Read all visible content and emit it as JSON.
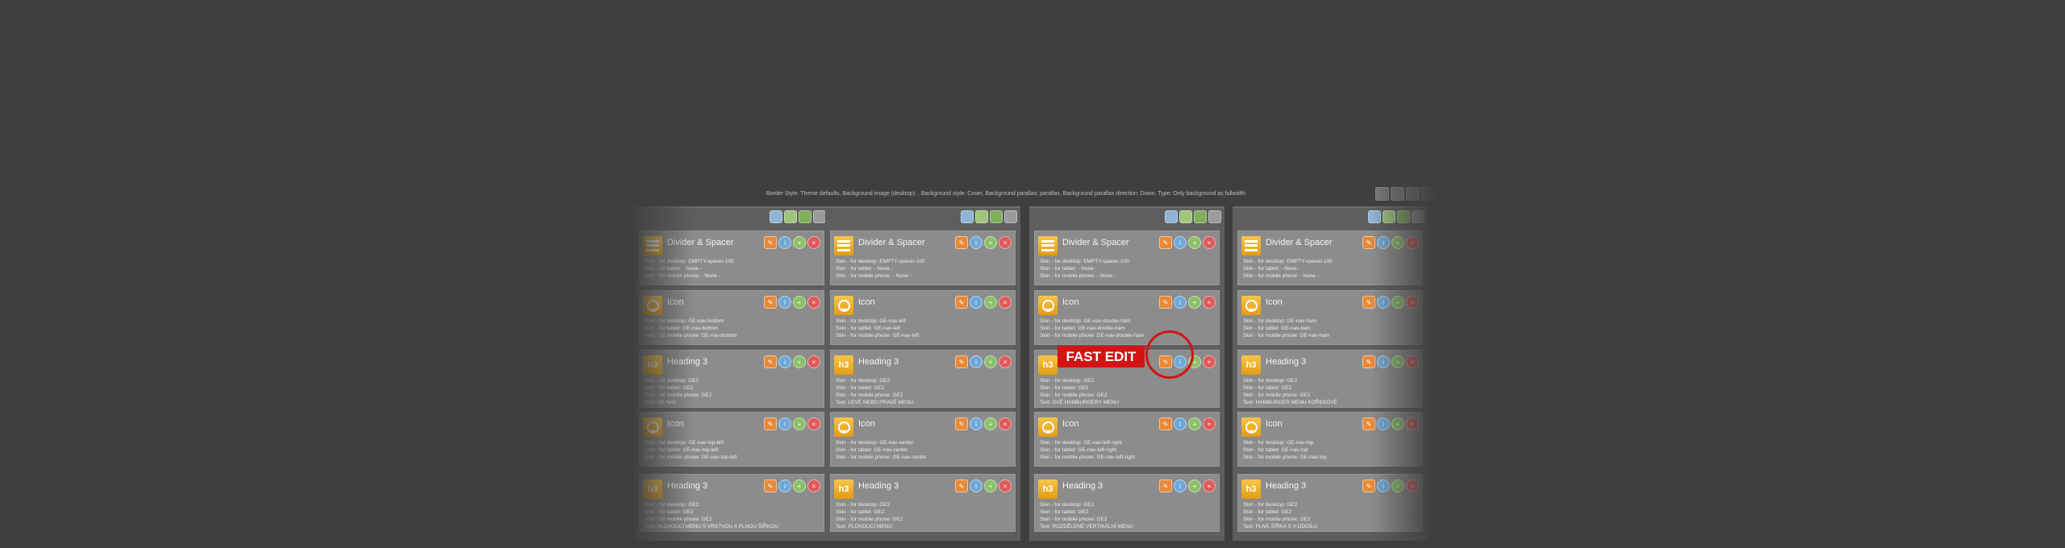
{
  "row_settings": {
    "text": "Border Style: Theme defaults, Background image (desktop):  , Background style: Cover, Background parallax: parallax, Background parallax direction: Down, Type: Only background as fullwidth"
  },
  "fast_edit": {
    "label": "FAST EDIT"
  },
  "columns": [
    {
      "modules": [
        {
          "icon": "divider-icon",
          "title": "Divider & Spacer",
          "lines": [
            "Skin - for desktop: EMPTY-spacer-100",
            "Skin - for tablet: - None -",
            "Skin - for mobile phone: - None -"
          ]
        },
        {
          "icon": "smiley-icon",
          "title": "Icon",
          "lines": [
            "Skin - for desktop: GE-nav-bottom",
            "Skin - for tablet: GE-nav-bottom",
            "Skin - for mobile phone: GE-nav-bottom"
          ]
        },
        {
          "icon": "h3-icon",
          "title": "Heading 3",
          "lines": [
            "Skin - for desktop: GE2",
            "Skin - for tablet: GE2",
            "Skin - for mobile phone: GE2",
            "Text: GE NAV"
          ]
        },
        {
          "icon": "smiley-icon",
          "title": "Icon",
          "lines": [
            "Skin - for desktop: GE-nav-top-left",
            "Skin - for tablet: GE-nav-top-left",
            "Skin - for mobile phone: GE-nav-top-left"
          ]
        },
        {
          "icon": "h3-icon",
          "title": "Heading 3",
          "lines": [
            "Skin - for desktop: GE2",
            "Skin - for tablet: GE2",
            "Skin - for mobile phone: GE2",
            "Text: PLOVOUCÍ MENU S VRSTVOU A PLNOU ŠÍŘKOU"
          ]
        }
      ]
    },
    {
      "modules": [
        {
          "icon": "divider-icon",
          "title": "Divider & Spacer",
          "lines": [
            "Skin - for desktop: EMPTY-spacer-100",
            "Skin - for tablet: - None -",
            "Skin - for mobile phone: - None -"
          ]
        },
        {
          "icon": "smiley-icon",
          "title": "Icon",
          "lines": [
            "Skin - for desktop: GE-nav-left",
            "Skin - for tablet: GE-nav-left",
            "Skin - for mobile phone: GE-nav-left"
          ]
        },
        {
          "icon": "h3-icon",
          "title": "Heading 3",
          "lines": [
            "Skin - for desktop: GE2",
            "Skin - for tablet: GE2",
            "Skin - for mobile phone: GE2",
            "Text: LEVÉ NEBO PRAVÉ MENU"
          ]
        },
        {
          "icon": "smiley-icon",
          "title": "Icon",
          "lines": [
            "Skin - for desktop: GE-nav-center",
            "Skin - for tablet: GE-nav-center",
            "Skin - for mobile phone: GE-nav-center"
          ]
        },
        {
          "icon": "h3-icon",
          "title": "Heading 3",
          "lines": [
            "Skin - for desktop: GE2",
            "Skin - for tablet: GE2",
            "Skin - for mobile phone: GE2",
            "Text: PLOVOUCÍ MENU"
          ]
        }
      ]
    },
    {
      "modules": [
        {
          "icon": "divider-icon",
          "title": "Divider & Spacer",
          "lines": [
            "Skin - for desktop: EMPTY-spacer-100",
            "Skin - for tablet: - None -",
            "Skin - for mobile phone: - None -"
          ]
        },
        {
          "icon": "smiley-icon",
          "title": "Icon",
          "lines": [
            "Skin - for desktop: GE-nav-double-ham",
            "Skin - for tablet: GE-nav-double-ham",
            "Skin - for mobile phone: GE-nav-double-ham"
          ]
        },
        {
          "icon": "h3-icon",
          "title": "Heading 3",
          "lines": [
            "Skin - for desktop: GE2",
            "Skin - for tablet: GE2",
            "Skin - for mobile phone: GE2",
            "Text: DVĚ HAMBURGERY MENU"
          ]
        },
        {
          "icon": "smiley-icon",
          "title": "Icon",
          "lines": [
            "Skin - for desktop: GE-nav-left-right",
            "Skin - for tablet: GE-nav-left-right",
            "Skin - for mobile phone: GE-nav-left-right"
          ]
        },
        {
          "icon": "h3-icon",
          "title": "Heading 3",
          "lines": [
            "Skin - for desktop: GE2",
            "Skin - for tablet: GE2",
            "Skin - for mobile phone: GE2",
            "Text: ROZDĚLENÉ VERTIKÁLNÍ MENU"
          ]
        }
      ]
    },
    {
      "modules": [
        {
          "icon": "divider-icon",
          "title": "Divider & Spacer",
          "lines": [
            "Skin - for desktop: EMPTY-spacer-100",
            "Skin - for tablet: - None -",
            "Skin - for mobile phone: - None -"
          ]
        },
        {
          "icon": "smiley-icon",
          "title": "Icon",
          "lines": [
            "Skin - for desktop: GE-nav-ham",
            "Skin - for tablet: GE-nav-ham",
            "Skin - for mobile phone: GE-nav-ham"
          ]
        },
        {
          "icon": "h3-icon",
          "title": "Heading 3",
          "lines": [
            "Skin - for desktop: GE2",
            "Skin - for tablet: GE2",
            "Skin - for mobile phone: GE2",
            "Text: HAMBURGER MENU KOŘEKOVÉ"
          ]
        },
        {
          "icon": "smiley-icon",
          "title": "Icon",
          "lines": [
            "Skin - for desktop: GE-nav-top",
            "Skin - for tablet: GE-nav-top",
            "Skin - for mobile phone: GE-nav-top"
          ]
        },
        {
          "icon": "h3-icon",
          "title": "Heading 3",
          "lines": [
            "Skin - for desktop: GE2",
            "Skin - for tablet: GE2",
            "Skin - for mobile phone: GE2",
            "Text: PLNÁ ŠÍŘKA S V-ODDÍLU"
          ]
        }
      ]
    }
  ]
}
